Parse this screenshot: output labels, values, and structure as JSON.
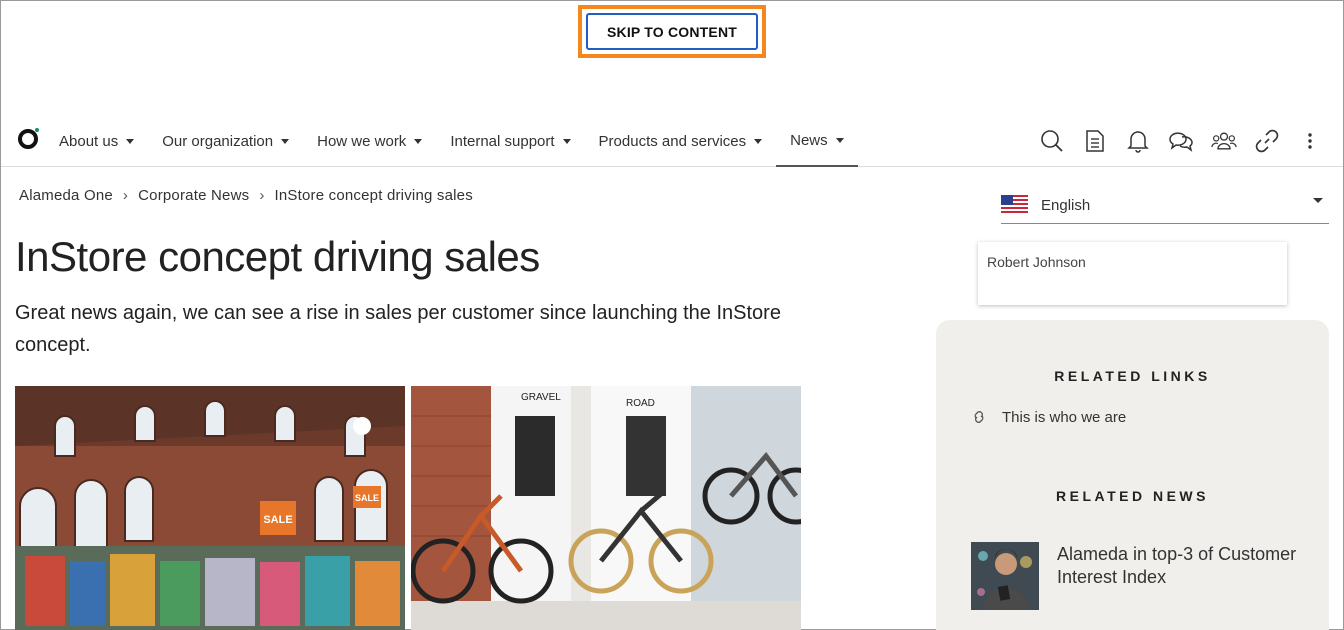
{
  "skip_link": {
    "label": "SKIP TO CONTENT"
  },
  "nav": {
    "items": [
      {
        "label": "About us"
      },
      {
        "label": "Our organization"
      },
      {
        "label": "How we work"
      },
      {
        "label": "Internal support"
      },
      {
        "label": "Products and services"
      },
      {
        "label": "News"
      }
    ],
    "active": "News",
    "icons": [
      "search-icon",
      "document-icon",
      "bell-icon",
      "chat-icon",
      "people-icon",
      "link-icon",
      "more-icon"
    ]
  },
  "breadcrumb": {
    "items": [
      {
        "label": "Alameda One"
      },
      {
        "label": "Corporate News"
      },
      {
        "label": "InStore concept driving sales"
      }
    ],
    "separator": "›"
  },
  "article": {
    "title": "InStore concept driving sales",
    "lead": "Great news again, we can see a rise in sales per customer since launching the InStore concept.",
    "images": [
      "store-interior-photo",
      "bike-display-photo"
    ],
    "photo_text": {
      "sale_sign": "SALE",
      "sale_sign_2": "SALE",
      "gravel_sign": "GRAVEL",
      "road_sign": "ROAD"
    }
  },
  "language": {
    "selected": "English",
    "flag": "us-flag-icon"
  },
  "author": {
    "name": "Robert Johnson"
  },
  "related_links": {
    "heading": "RELATED LINKS",
    "items": [
      {
        "label": "This is who we are"
      }
    ]
  },
  "related_news": {
    "heading": "RELATED NEWS",
    "items": [
      {
        "title": "Alameda in top-3 of Customer Interest Index"
      }
    ]
  },
  "colors": {
    "skip_focus": "#f5871f",
    "skip_border": "#1f5fc4",
    "panel_bg": "#f0efeb"
  }
}
